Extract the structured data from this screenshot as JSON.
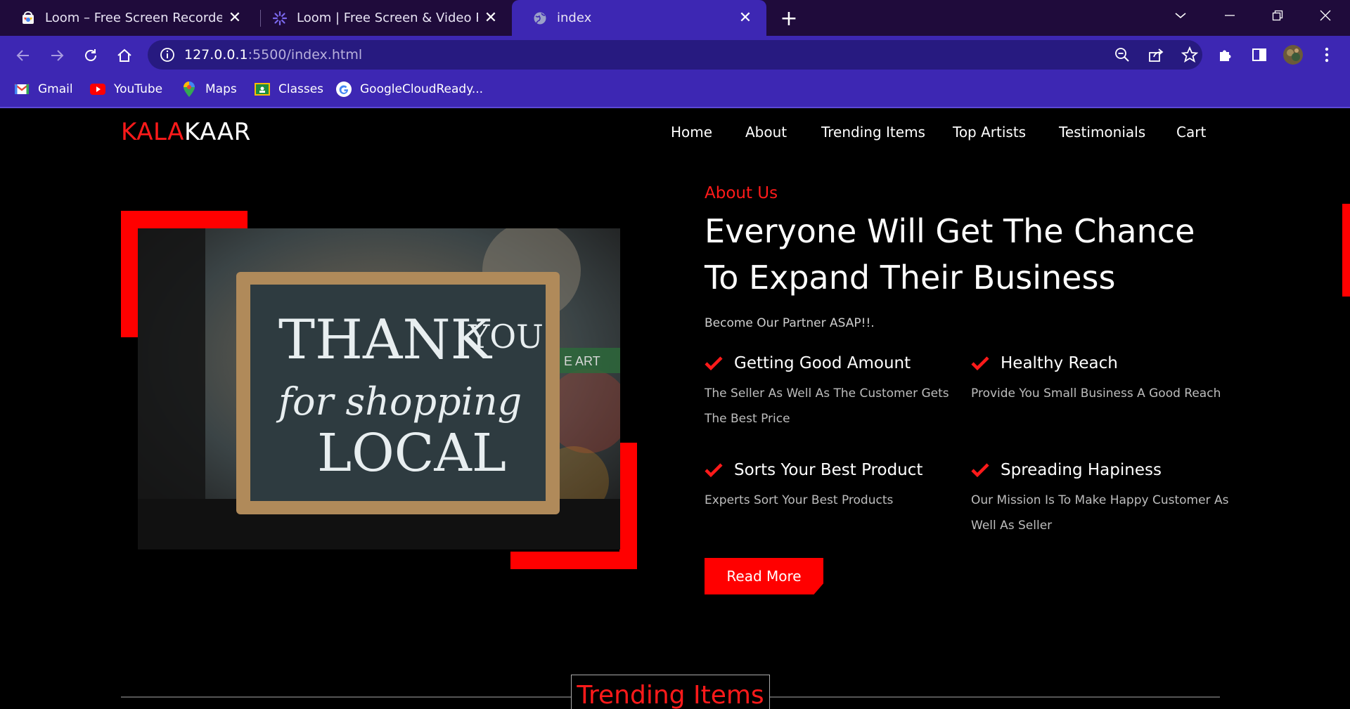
{
  "browser": {
    "tabs": [
      {
        "title": "Loom – Free Screen Recorder & S",
        "active": false
      },
      {
        "title": "Loom | Free Screen & Video Reco",
        "active": false
      },
      {
        "title": "index",
        "active": true
      }
    ],
    "url_host": "127.0.0.1",
    "url_path": ":5500/index.html",
    "bookmarks": [
      "Gmail",
      "YouTube",
      "Maps",
      "Classes",
      "GoogleCloudReady..."
    ]
  },
  "site": {
    "logo_red": "KALA",
    "logo_white": "KAAR",
    "nav": [
      "Home",
      "About",
      "Trending Items",
      "Top Artists",
      "Testimonials",
      "Cart"
    ],
    "about": {
      "label": "About Us",
      "heading": "Everyone Will Get The Chance To Expand Their Business",
      "subtitle": "Become Our Partner ASAP!!.",
      "features": [
        {
          "title": "Getting Good Amount",
          "desc": "The Seller As Well As The Customer Gets The Best Price"
        },
        {
          "title": "Healthy Reach",
          "desc": "Provide You Small Business A Good Reach"
        },
        {
          "title": "Sorts Your Best Product",
          "desc": "Experts Sort Your Best Products"
        },
        {
          "title": "Spreading Hapiness",
          "desc": "Our Mission Is To Make Happy Customer As Well As Seller"
        }
      ],
      "read_more": "Read More",
      "image": {
        "line1": "THANK",
        "line1b": "YOU",
        "line2": "for shopping",
        "line3": "LOCAL",
        "side": "E ART"
      }
    },
    "trending_title": "Trending Items"
  },
  "colors": {
    "accent": "#ff0000",
    "tabbar": "#1f0b3b",
    "toolbar": "#3d27b3"
  }
}
